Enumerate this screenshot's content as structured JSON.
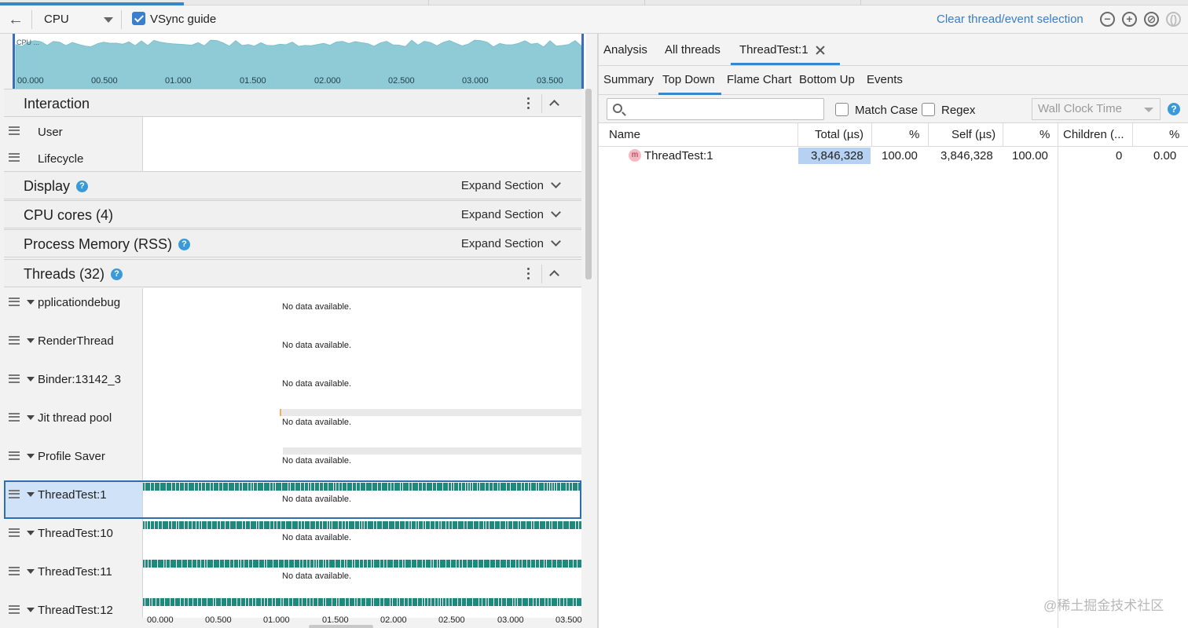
{
  "toolbar": {
    "back_icon": "back-arrow-icon",
    "cpu_select_value": "CPU",
    "vsync_label": "VSync guide",
    "vsync_checked": true,
    "clear_selection_label": "Clear thread/event selection",
    "zoom_out_glyph": "−",
    "zoom_in_glyph": "+",
    "reset_glyph": "⊘",
    "attach_glyph": "()"
  },
  "overview": {
    "label": "CPU ...",
    "ticks": [
      "00.000",
      "00.500",
      "01.000",
      "01.500",
      "02.000",
      "02.500",
      "03.000",
      "03.500"
    ],
    "fill_color": "#8fcbd6"
  },
  "sections": {
    "interaction": {
      "title": "Interaction",
      "rows": [
        "User",
        "Lifecycle"
      ]
    },
    "display": {
      "title": "Display",
      "expand_label": "Expand Section"
    },
    "cpu_cores": {
      "title": "CPU cores (4)",
      "expand_label": "Expand Section"
    },
    "process_memory": {
      "title": "Process Memory (RSS)",
      "expand_label": "Expand Section"
    },
    "threads": {
      "title": "Threads (32)",
      "no_data": "No data available.",
      "items": [
        "pplicationdebug",
        "RenderThread",
        "Binder:13142_3",
        "Jit thread pool",
        "Profile Saver",
        "ThreadTest:1",
        "ThreadTest:10",
        "ThreadTest:11",
        "ThreadTest:12"
      ]
    }
  },
  "bottom_ticks": [
    "00.000",
    "00.500",
    "01.000",
    "01.500",
    "02.000",
    "02.500",
    "03.000",
    "03.500"
  ],
  "right": {
    "tabs": [
      "Analysis",
      "All threads",
      "ThreadTest:1"
    ],
    "subtabs": [
      "Summary",
      "Top Down",
      "Flame Chart",
      "Bottom Up",
      "Events"
    ],
    "search_placeholder": "",
    "match_case_label": "Match Case",
    "regex_label": "Regex",
    "clock_select_value": "Wall Clock Time",
    "help_glyph": "?",
    "columns": [
      "Name",
      "Total (µs)",
      "%",
      "Self (µs)",
      "%",
      "Children (...",
      "%"
    ],
    "rows": [
      {
        "badge": "m",
        "name": "ThreadTest:1",
        "total": "3,846,328",
        "total_pct": "100.00",
        "self": "3,846,328",
        "self_pct": "100.00",
        "children": "0",
        "children_pct": "0.00"
      }
    ]
  },
  "watermark": "@稀土掘金技术社区",
  "colors": {
    "accent": "#3b86c8",
    "trace": "#1e8a7e",
    "selection": "#cfe2f7"
  }
}
